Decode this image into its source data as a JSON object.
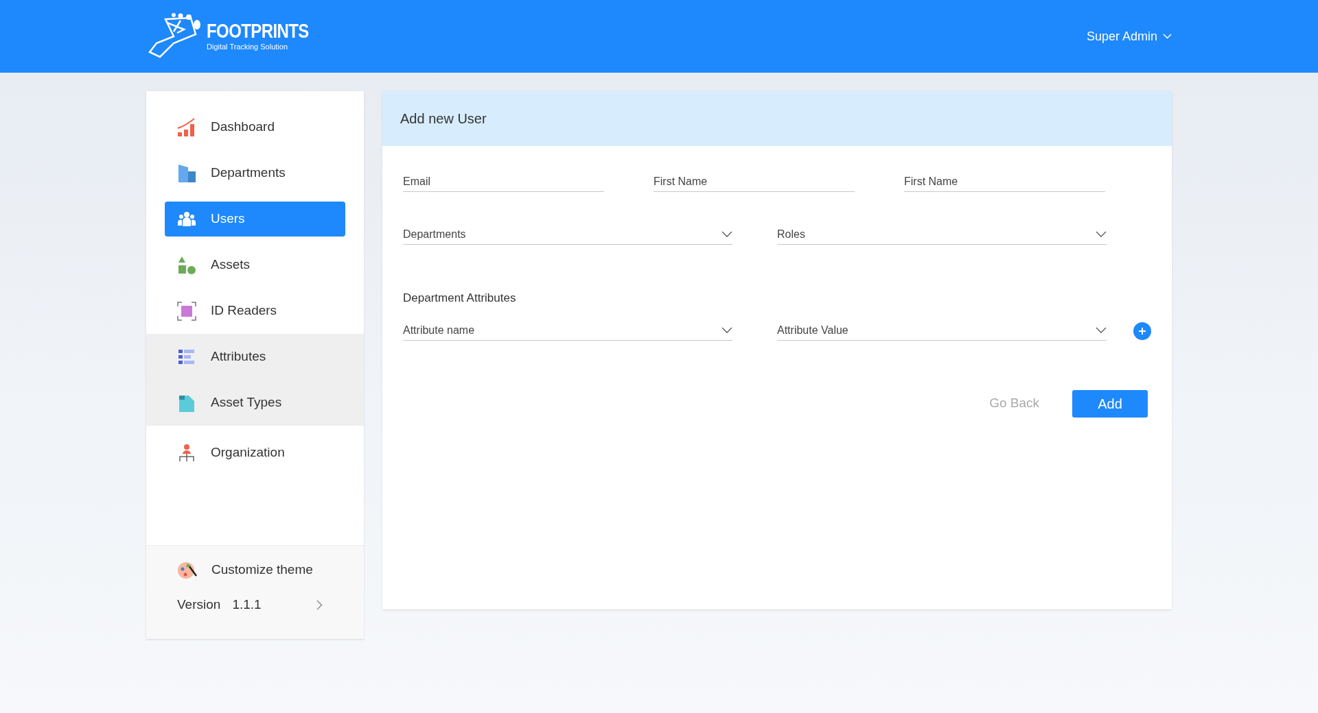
{
  "brand": {
    "name": "FOOTPRINTS",
    "tagline": "Digital Tracking Solution"
  },
  "user_menu": {
    "label": "Super Admin"
  },
  "sidebar": {
    "items": [
      {
        "label": "Dashboard",
        "selected": false,
        "shaded": false
      },
      {
        "label": "Departments",
        "selected": false,
        "shaded": false
      },
      {
        "label": "Users",
        "selected": true,
        "shaded": false
      },
      {
        "label": "Assets",
        "selected": false,
        "shaded": false
      },
      {
        "label": "ID Readers",
        "selected": false,
        "shaded": false
      },
      {
        "label": "Attributes",
        "selected": false,
        "shaded": true
      },
      {
        "label": "Asset Types",
        "selected": false,
        "shaded": true
      },
      {
        "label": "Organization",
        "selected": false,
        "shaded": false
      }
    ],
    "customize": "Customize theme",
    "version_label": "Version",
    "version": "1.1.1"
  },
  "form": {
    "title": "Add new User",
    "rows": [
      [
        {
          "kind": "text",
          "placeholder": "Email"
        },
        {
          "kind": "text",
          "placeholder": "First Name"
        },
        {
          "kind": "text",
          "placeholder": "First Name"
        }
      ],
      [
        {
          "kind": "select",
          "placeholder": "Departments"
        },
        {
          "kind": "select",
          "placeholder": "Roles"
        }
      ]
    ],
    "attributes_heading": "Department Attributes",
    "attribute_fields": [
      {
        "kind": "select",
        "placeholder": "Attribute name"
      },
      {
        "kind": "select",
        "placeholder": "Attribute Value"
      }
    ],
    "buttons": [
      {
        "kind": "secondary",
        "label": "Go Back"
      },
      {
        "kind": "primary",
        "label": "Add"
      }
    ]
  }
}
